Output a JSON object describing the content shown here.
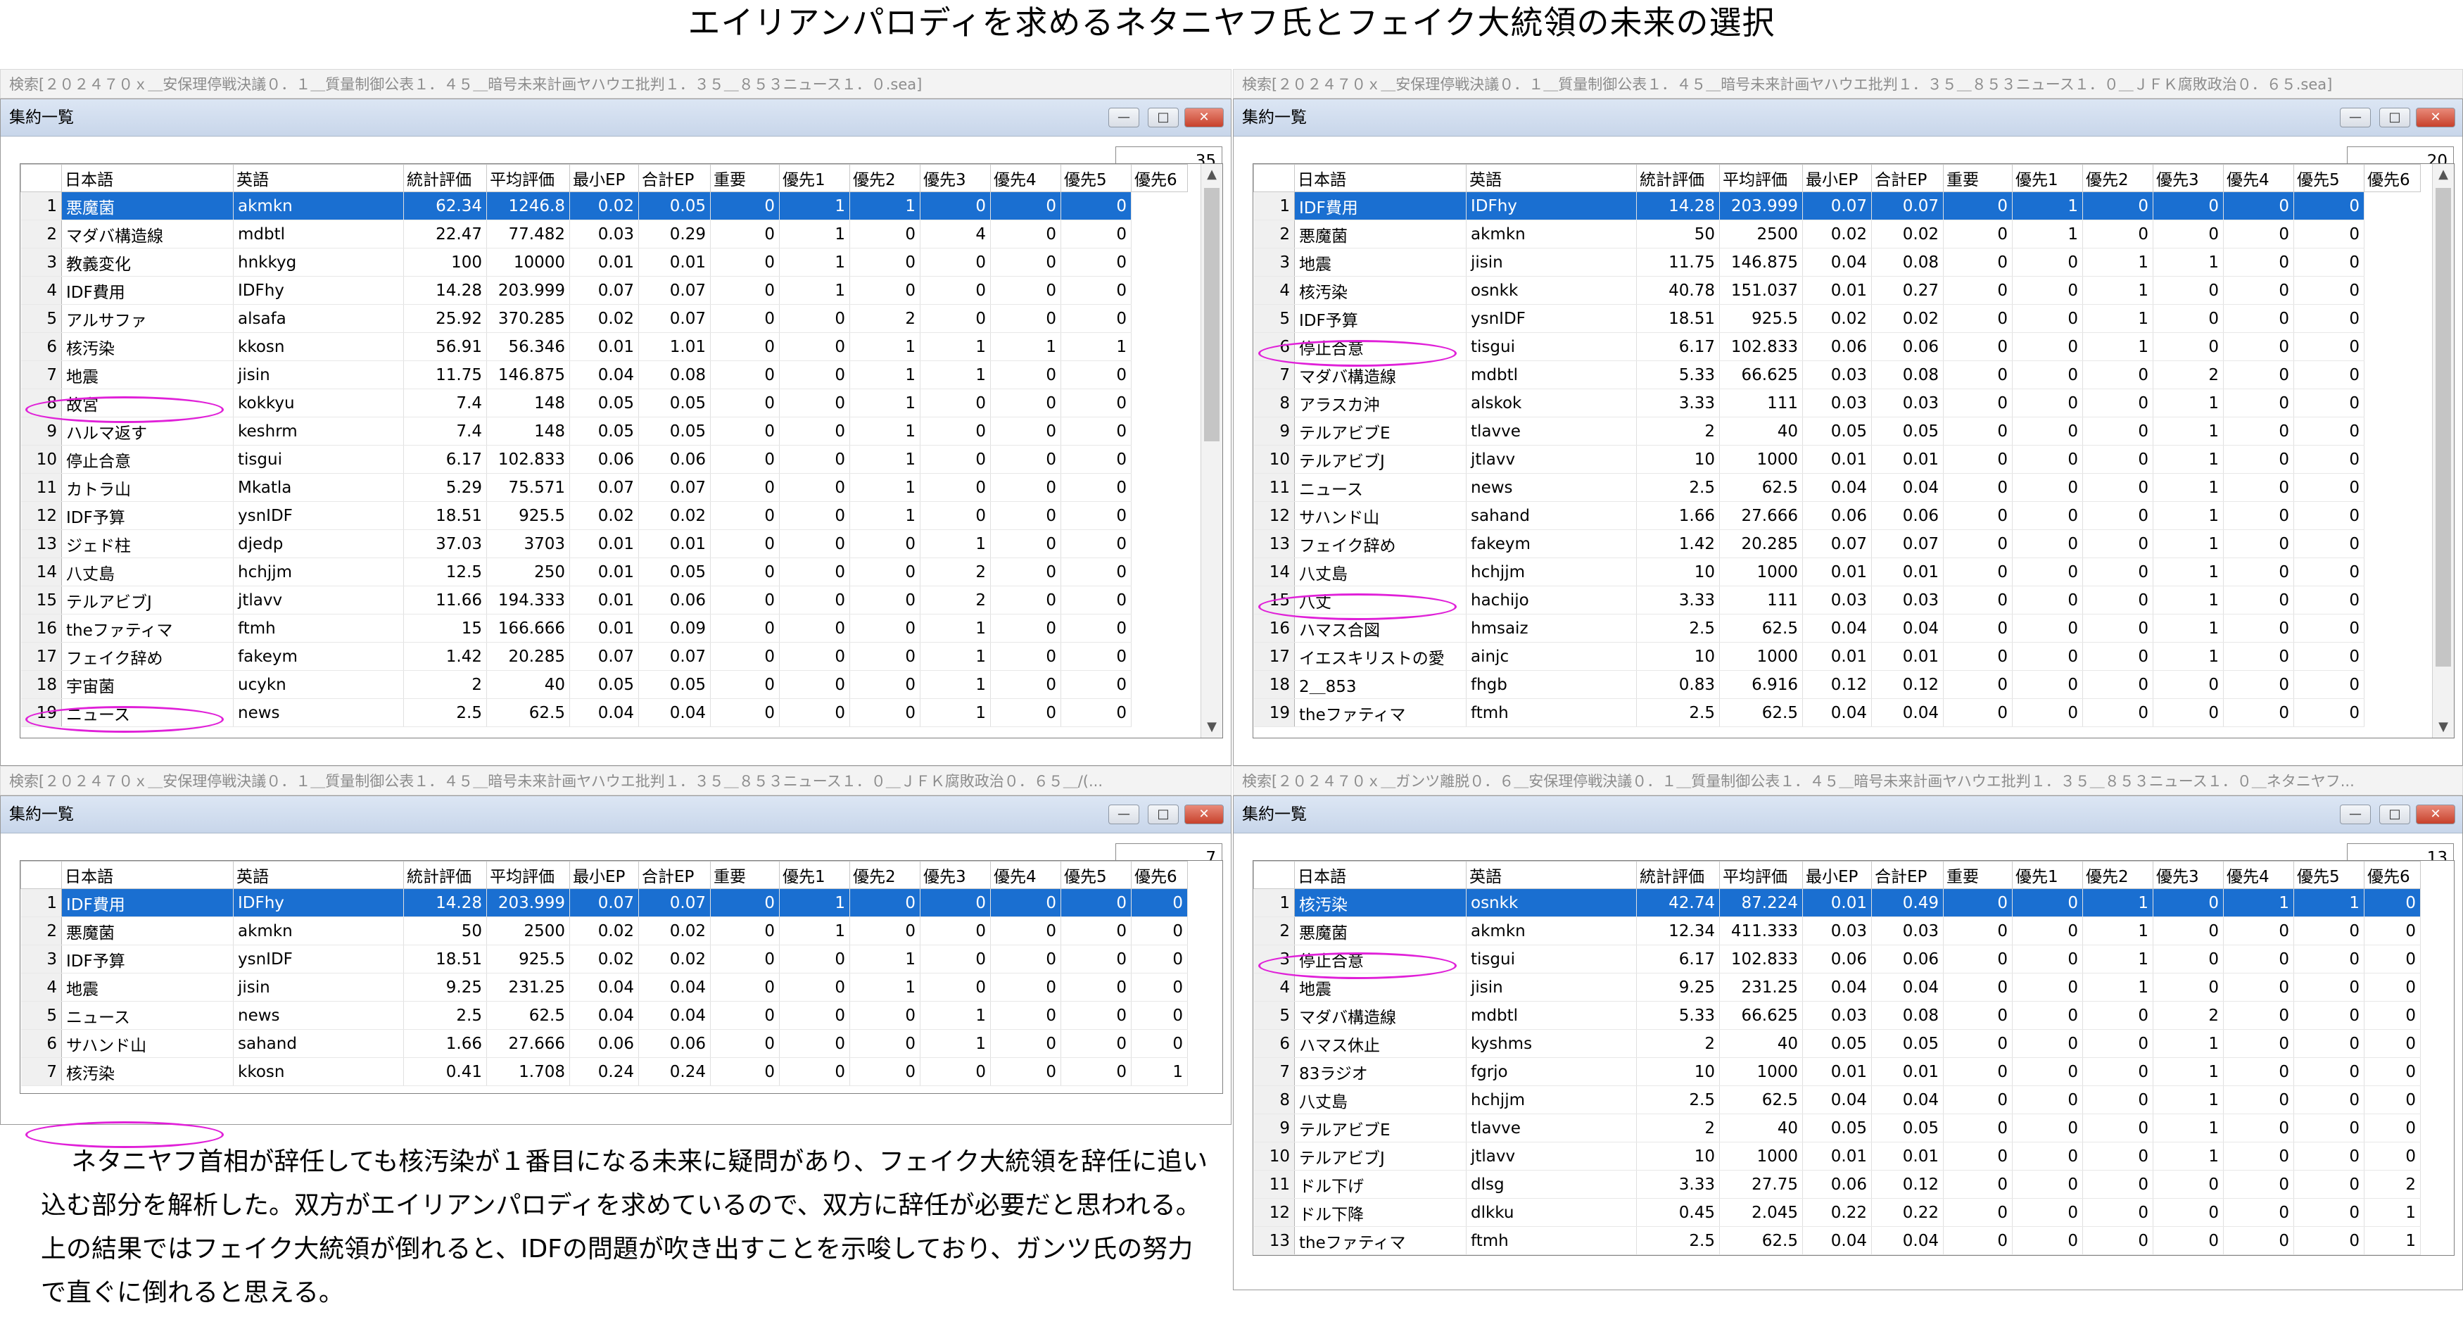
{
  "title": "エイリアンパロディを求めるネタニヤフ氏とフェイク大統領の未来の選択",
  "window_title": "集約一覧",
  "columns": [
    "日本語",
    "英語",
    "統計評価",
    "平均評価",
    "最小EP",
    "合計EP",
    "重要",
    "優先1",
    "優先2",
    "優先3",
    "優先4",
    "優先5",
    "優先6"
  ],
  "panels": [
    {
      "search": "検索[２０２４７０ｘ＿安保理停戦決議０．１＿質量制御公表１．４５＿暗号未来計画ヤハウエ批判１．３５＿８５３ニュース１．０.sea]",
      "count": "35",
      "rows": [
        [
          "1",
          "悪魔菌",
          "akmkn",
          "62.34",
          "1246.8",
          "0.02",
          "0.05",
          "0",
          "1",
          "1",
          "0",
          "0",
          "0"
        ],
        [
          "2",
          "マダバ構造線",
          "mdbtl",
          "22.47",
          "77.482",
          "0.03",
          "0.29",
          "0",
          "1",
          "0",
          "4",
          "0",
          "0"
        ],
        [
          "3",
          "教義変化",
          "hnkkyg",
          "100",
          "10000",
          "0.01",
          "0.01",
          "0",
          "1",
          "0",
          "0",
          "0",
          "0"
        ],
        [
          "4",
          "IDF費用",
          "IDFhy",
          "14.28",
          "203.999",
          "0.07",
          "0.07",
          "0",
          "1",
          "0",
          "0",
          "0",
          "0"
        ],
        [
          "5",
          "アルサファ",
          "alsafa",
          "25.92",
          "370.285",
          "0.02",
          "0.07",
          "0",
          "0",
          "2",
          "0",
          "0",
          "0"
        ],
        [
          "6",
          "核汚染",
          "kkosn",
          "56.91",
          "56.346",
          "0.01",
          "1.01",
          "0",
          "0",
          "1",
          "1",
          "1",
          "1"
        ],
        [
          "7",
          "地震",
          "jisin",
          "11.75",
          "146.875",
          "0.04",
          "0.08",
          "0",
          "0",
          "1",
          "1",
          "0",
          "0"
        ],
        [
          "8",
          "故宮",
          "kokkyu",
          "7.4",
          "148",
          "0.05",
          "0.05",
          "0",
          "0",
          "1",
          "0",
          "0",
          "0"
        ],
        [
          "9",
          "ハルマ返す",
          "keshrm",
          "7.4",
          "148",
          "0.05",
          "0.05",
          "0",
          "0",
          "1",
          "0",
          "0",
          "0"
        ],
        [
          "10",
          "停止合意",
          "tisgui",
          "6.17",
          "102.833",
          "0.06",
          "0.06",
          "0",
          "0",
          "1",
          "0",
          "0",
          "0"
        ],
        [
          "11",
          "カトラ山",
          "Mkatla",
          "5.29",
          "75.571",
          "0.07",
          "0.07",
          "0",
          "0",
          "1",
          "0",
          "0",
          "0"
        ],
        [
          "12",
          "IDF予算",
          "ysnIDF",
          "18.51",
          "925.5",
          "0.02",
          "0.02",
          "0",
          "0",
          "1",
          "0",
          "0",
          "0"
        ],
        [
          "13",
          "ジェド柱",
          "djedp",
          "37.03",
          "3703",
          "0.01",
          "0.01",
          "0",
          "0",
          "0",
          "1",
          "0",
          "0"
        ],
        [
          "14",
          "八丈島",
          "hchjjm",
          "12.5",
          "250",
          "0.01",
          "0.05",
          "0",
          "0",
          "0",
          "2",
          "0",
          "0"
        ],
        [
          "15",
          "テルアビブJ",
          "jtlavv",
          "11.66",
          "194.333",
          "0.01",
          "0.06",
          "0",
          "0",
          "0",
          "2",
          "0",
          "0"
        ],
        [
          "16",
          "theファティマ",
          "ftmh",
          "15",
          "166.666",
          "0.01",
          "0.09",
          "0",
          "0",
          "0",
          "1",
          "0",
          "0"
        ],
        [
          "17",
          "フェイク辞め",
          "fakeym",
          "1.42",
          "20.285",
          "0.07",
          "0.07",
          "0",
          "0",
          "0",
          "1",
          "0",
          "0"
        ],
        [
          "18",
          "宇宙菌",
          "ucykn",
          "2",
          "40",
          "0.05",
          "0.05",
          "0",
          "0",
          "0",
          "1",
          "0",
          "0"
        ],
        [
          "19",
          "ニュース",
          "news",
          "2.5",
          "62.5",
          "0.04",
          "0.04",
          "0",
          "0",
          "0",
          "1",
          "0",
          "0"
        ]
      ]
    },
    {
      "search": "検索[２０２４７０ｘ＿安保理停戦決議０．１＿質量制御公表１．４５＿暗号未来計画ヤハウエ批判１．３５＿８５３ニュース１．０＿ＪＦＫ腐敗政治０．６５.sea]",
      "count": "20",
      "rows": [
        [
          "1",
          "IDF費用",
          "IDFhy",
          "14.28",
          "203.999",
          "0.07",
          "0.07",
          "0",
          "1",
          "0",
          "0",
          "0",
          "0"
        ],
        [
          "2",
          "悪魔菌",
          "akmkn",
          "50",
          "2500",
          "0.02",
          "0.02",
          "0",
          "1",
          "0",
          "0",
          "0",
          "0"
        ],
        [
          "3",
          "地震",
          "jisin",
          "11.75",
          "146.875",
          "0.04",
          "0.08",
          "0",
          "0",
          "1",
          "1",
          "0",
          "0"
        ],
        [
          "4",
          "核汚染",
          "osnkk",
          "40.78",
          "151.037",
          "0.01",
          "0.27",
          "0",
          "0",
          "1",
          "0",
          "0",
          "0"
        ],
        [
          "5",
          "IDF予算",
          "ysnIDF",
          "18.51",
          "925.5",
          "0.02",
          "0.02",
          "0",
          "0",
          "1",
          "0",
          "0",
          "0"
        ],
        [
          "6",
          "停止合意",
          "tisgui",
          "6.17",
          "102.833",
          "0.06",
          "0.06",
          "0",
          "0",
          "1",
          "0",
          "0",
          "0"
        ],
        [
          "7",
          "マダバ構造線",
          "mdbtl",
          "5.33",
          "66.625",
          "0.03",
          "0.08",
          "0",
          "0",
          "0",
          "2",
          "0",
          "0"
        ],
        [
          "8",
          "アラスカ沖",
          "alskok",
          "3.33",
          "111",
          "0.03",
          "0.03",
          "0",
          "0",
          "0",
          "1",
          "0",
          "0"
        ],
        [
          "9",
          "テルアビブE",
          "tlavve",
          "2",
          "40",
          "0.05",
          "0.05",
          "0",
          "0",
          "0",
          "1",
          "0",
          "0"
        ],
        [
          "10",
          "テルアビブJ",
          "jtlavv",
          "10",
          "1000",
          "0.01",
          "0.01",
          "0",
          "0",
          "0",
          "1",
          "0",
          "0"
        ],
        [
          "11",
          "ニュース",
          "news",
          "2.5",
          "62.5",
          "0.04",
          "0.04",
          "0",
          "0",
          "0",
          "1",
          "0",
          "0"
        ],
        [
          "12",
          "サハンド山",
          "sahand",
          "1.66",
          "27.666",
          "0.06",
          "0.06",
          "0",
          "0",
          "0",
          "1",
          "0",
          "0"
        ],
        [
          "13",
          "フェイク辞め",
          "fakeym",
          "1.42",
          "20.285",
          "0.07",
          "0.07",
          "0",
          "0",
          "0",
          "1",
          "0",
          "0"
        ],
        [
          "14",
          "八丈島",
          "hchjjm",
          "10",
          "1000",
          "0.01",
          "0.01",
          "0",
          "0",
          "0",
          "1",
          "0",
          "0"
        ],
        [
          "15",
          "八丈",
          "hachijo",
          "3.33",
          "111",
          "0.03",
          "0.03",
          "0",
          "0",
          "0",
          "1",
          "0",
          "0"
        ],
        [
          "16",
          "ハマス合図",
          "hmsaiz",
          "2.5",
          "62.5",
          "0.04",
          "0.04",
          "0",
          "0",
          "0",
          "1",
          "0",
          "0"
        ],
        [
          "17",
          "イエスキリストの愛",
          "ainjc",
          "10",
          "1000",
          "0.01",
          "0.01",
          "0",
          "0",
          "0",
          "1",
          "0",
          "0"
        ],
        [
          "18",
          "2＿853",
          "fhgb",
          "0.83",
          "6.916",
          "0.12",
          "0.12",
          "0",
          "0",
          "0",
          "0",
          "0",
          "0"
        ],
        [
          "19",
          "theファティマ",
          "ftmh",
          "2.5",
          "62.5",
          "0.04",
          "0.04",
          "0",
          "0",
          "0",
          "0",
          "0",
          "0"
        ]
      ]
    },
    {
      "search": "検索[２０２４７０ｘ＿安保理停戦決議０．１＿質量制御公表１．４５＿暗号未来計画ヤハウエ批判１．３５＿８５３ニュース１．０＿ＪＦＫ腐敗政治０．６５＿/(...",
      "count": "7",
      "rows": [
        [
          "1",
          "IDF費用",
          "IDFhy",
          "14.28",
          "203.999",
          "0.07",
          "0.07",
          "0",
          "1",
          "0",
          "0",
          "0",
          "0",
          "0"
        ],
        [
          "2",
          "悪魔菌",
          "akmkn",
          "50",
          "2500",
          "0.02",
          "0.02",
          "0",
          "1",
          "0",
          "0",
          "0",
          "0",
          "0"
        ],
        [
          "3",
          "IDF予算",
          "ysnIDF",
          "18.51",
          "925.5",
          "0.02",
          "0.02",
          "0",
          "0",
          "1",
          "0",
          "0",
          "0",
          "0"
        ],
        [
          "4",
          "地震",
          "jisin",
          "9.25",
          "231.25",
          "0.04",
          "0.04",
          "0",
          "0",
          "1",
          "0",
          "0",
          "0",
          "0"
        ],
        [
          "5",
          "ニュース",
          "news",
          "2.5",
          "62.5",
          "0.04",
          "0.04",
          "0",
          "0",
          "0",
          "1",
          "0",
          "0",
          "0"
        ],
        [
          "6",
          "サハンド山",
          "sahand",
          "1.66",
          "27.666",
          "0.06",
          "0.06",
          "0",
          "0",
          "0",
          "1",
          "0",
          "0",
          "0"
        ],
        [
          "7",
          "核汚染",
          "kkosn",
          "0.41",
          "1.708",
          "0.24",
          "0.24",
          "0",
          "0",
          "0",
          "0",
          "0",
          "0",
          "1"
        ]
      ]
    },
    {
      "search": "検索[２０２４７０ｘ＿ガンツ離脱０．６＿安保理停戦決議０．１＿質量制御公表１．４５＿暗号未来計画ヤハウエ批判１．３５＿８５３ニュース１．０＿ネタニヤフ...",
      "count": "13",
      "rows": [
        [
          "1",
          "核汚染",
          "osnkk",
          "42.74",
          "87.224",
          "0.01",
          "0.49",
          "0",
          "0",
          "1",
          "0",
          "1",
          "1",
          "0"
        ],
        [
          "2",
          "悪魔菌",
          "akmkn",
          "12.34",
          "411.333",
          "0.03",
          "0.03",
          "0",
          "0",
          "1",
          "0",
          "0",
          "0",
          "0"
        ],
        [
          "3",
          "停止合意",
          "tisgui",
          "6.17",
          "102.833",
          "0.06",
          "0.06",
          "0",
          "0",
          "1",
          "0",
          "0",
          "0",
          "0"
        ],
        [
          "4",
          "地震",
          "jisin",
          "9.25",
          "231.25",
          "0.04",
          "0.04",
          "0",
          "0",
          "1",
          "0",
          "0",
          "0",
          "0"
        ],
        [
          "5",
          "マダバ構造線",
          "mdbtl",
          "5.33",
          "66.625",
          "0.03",
          "0.08",
          "0",
          "0",
          "0",
          "2",
          "0",
          "0",
          "0"
        ],
        [
          "6",
          "ハマス休止",
          "kyshms",
          "2",
          "40",
          "0.05",
          "0.05",
          "0",
          "0",
          "0",
          "1",
          "0",
          "0",
          "0"
        ],
        [
          "7",
          "83ラジオ",
          "fgrjo",
          "10",
          "1000",
          "0.01",
          "0.01",
          "0",
          "0",
          "0",
          "1",
          "0",
          "0",
          "0"
        ],
        [
          "8",
          "八丈島",
          "hchjjm",
          "2.5",
          "62.5",
          "0.04",
          "0.04",
          "0",
          "0",
          "0",
          "1",
          "0",
          "0",
          "0"
        ],
        [
          "9",
          "テルアビブE",
          "tlavve",
          "2",
          "40",
          "0.05",
          "0.05",
          "0",
          "0",
          "0",
          "1",
          "0",
          "0",
          "0"
        ],
        [
          "10",
          "テルアビブJ",
          "jtlavv",
          "10",
          "1000",
          "0.01",
          "0.01",
          "0",
          "0",
          "0",
          "1",
          "0",
          "0",
          "0"
        ],
        [
          "11",
          "ドル下げ",
          "dlsg",
          "3.33",
          "27.75",
          "0.06",
          "0.12",
          "0",
          "0",
          "0",
          "0",
          "0",
          "0",
          "2"
        ],
        [
          "12",
          "ドル下降",
          "dlkku",
          "0.45",
          "2.045",
          "0.22",
          "0.22",
          "0",
          "0",
          "0",
          "0",
          "0",
          "0",
          "1"
        ],
        [
          "13",
          "theファティマ",
          "ftmh",
          "2.5",
          "62.5",
          "0.04",
          "0.04",
          "0",
          "0",
          "0",
          "0",
          "0",
          "0",
          "1"
        ]
      ]
    }
  ],
  "note": "ネタニヤフ首相が辞任しても核汚染が１番目になる未来に疑問があり、フェイク大統領を辞任に追い込む部分を解析した。双方がエイリアンパロディを求めているので、双方に辞任が必要だと思われる。上の結果ではフェイク大統領が倒れると、IDFの問題が吹き出すことを示唆しており、ガンツ氏の努力で直ぐに倒れると思える。",
  "colors": {
    "selection": "#1a6fd1",
    "highlight_oval": "#e020d8",
    "titlebar": "#c8d6ea"
  }
}
